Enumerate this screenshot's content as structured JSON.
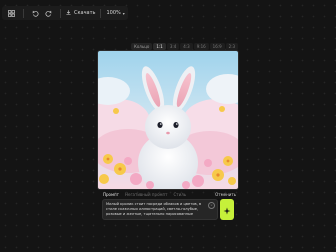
{
  "toolbar": {
    "undo_icon": "undo-icon",
    "redo_icon": "redo-icon",
    "download_label": "Скачать",
    "zoom_label": "100%"
  },
  "ratio_bar": {
    "label": "Кольцо",
    "options": [
      "1:1",
      "3:4",
      "4:3",
      "9:16",
      "16:9",
      "2:3"
    ],
    "selected": "1:1"
  },
  "image": {
    "description_icon": "bunny-image"
  },
  "panel": {
    "tabs": [
      "Промпт",
      "Негативный промпт",
      "Стиль"
    ],
    "active_tab": "Промпт",
    "cancel_label": "Отменить",
    "prompt_text": "Милый кролик стоит посреди облаков и цветов, в стиле сказочных иллюстраций, светло-голубые, розовые и желтые, тщательно нарисованные"
  },
  "colors": {
    "accent": "#c6f03a",
    "background": "#141414"
  }
}
